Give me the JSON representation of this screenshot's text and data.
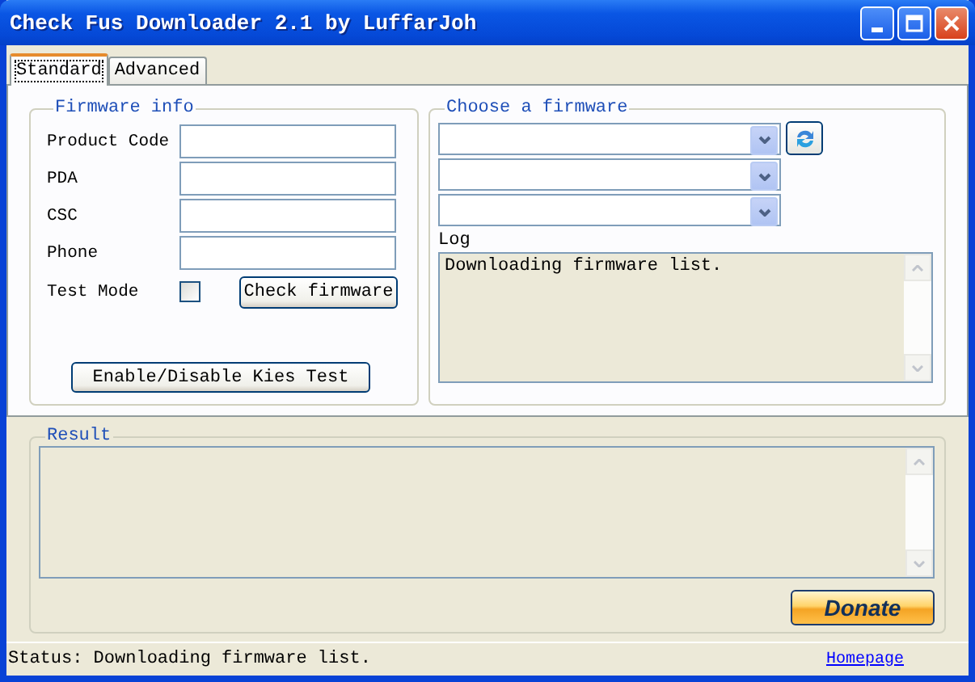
{
  "window": {
    "title": "Check Fus Downloader 2.1 by LuffarJoh"
  },
  "tabs": [
    {
      "label": "Standard",
      "selected": true
    },
    {
      "label": "Advanced",
      "selected": false
    }
  ],
  "firmware_info": {
    "title": "Firmware info",
    "fields": [
      {
        "label": "Product Code"
      },
      {
        "label": "PDA"
      },
      {
        "label": "CSC"
      },
      {
        "label": "Phone"
      }
    ],
    "test_mode": {
      "label": "Test Mode",
      "checked": false
    },
    "check_button": "Check firmware",
    "kies_button": "Enable/Disable Kies Test"
  },
  "choose_firmware": {
    "title": "Choose a firmware",
    "dropdowns": [
      {
        "kind": "with-refresh"
      },
      {
        "kind": "plain"
      },
      {
        "kind": "plain"
      }
    ],
    "log": {
      "label": "Log",
      "text": "Downloading firmware list."
    }
  },
  "result": {
    "title": "Result"
  },
  "donate_button": "Donate",
  "status_bar": {
    "text": "Status: Downloading firmware list.",
    "link": "Homepage"
  }
}
